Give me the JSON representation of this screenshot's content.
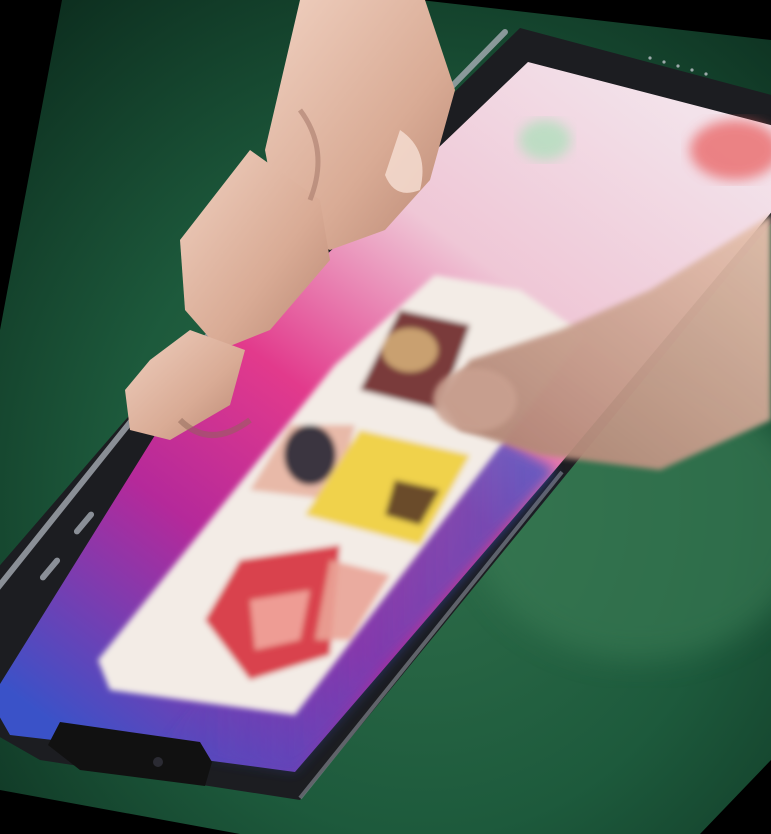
{
  "scene": {
    "colors": {
      "backdrop_dark": "#0b2a1c",
      "backdrop_mid": "#1d5a3c",
      "backdrop_light": "#2f6e4a",
      "corner_black": "#000000",
      "phone_frame": "#1c1d21",
      "phone_rim": "#9aa0a8",
      "screen_top": "#f0dde6",
      "screen_pink": "#e23a8c",
      "screen_magenta": "#b5299a",
      "screen_blue": "#3a52c8",
      "card_bg": "#f3ece6",
      "tile_peach": "#e8b9a8",
      "tile_yellow": "#f0d24c",
      "tile_red": "#d9434e",
      "skin_light": "#e9c6b4",
      "skin_mid": "#d6a892",
      "skin_shadow": "#b98672"
    },
    "icons": [
      "phone-device",
      "app-switcher-card",
      "hand",
      "thumb"
    ]
  }
}
